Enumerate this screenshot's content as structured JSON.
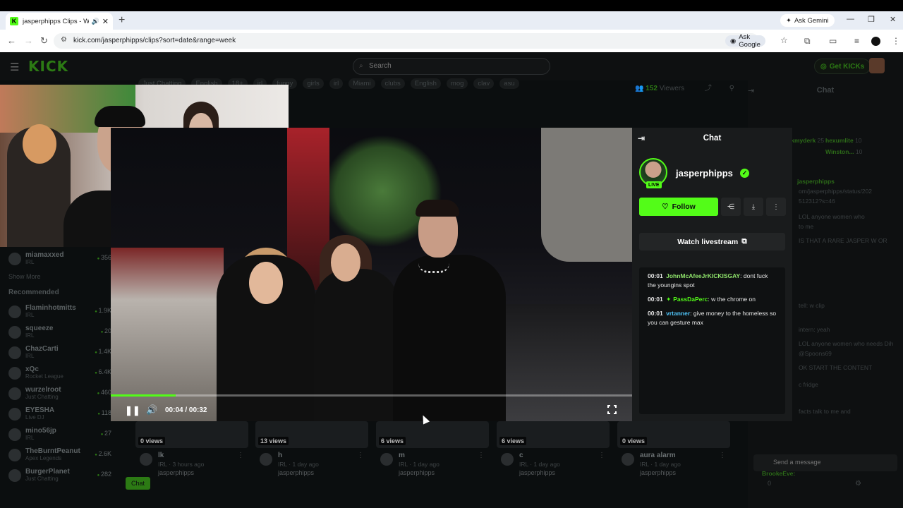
{
  "browser": {
    "tab_title": "jasperphipps Clips - Watch",
    "tab_favicon": "K",
    "new_tab": "+",
    "ask_gemini": "Ask Gemini",
    "url": "kick.com/jasperphipps/clips?sort=date&range=week",
    "ask_google": "Ask Google"
  },
  "topbar": {
    "logo": "KICK",
    "search_placeholder": "Search",
    "get_kicks": "Get KICKs"
  },
  "stream_info": {
    "tags": [
      "Just Chatting",
      "English",
      "18+",
      "irl",
      "funny",
      "girls",
      "irl",
      "Miami",
      "clubs",
      "English",
      "mog",
      "clav",
      "asu"
    ],
    "viewers_count": "152",
    "viewers_label": "Viewers"
  },
  "sidebar": {
    "following_tail": [
      {
        "name": "miamaxxed",
        "category": "IRL",
        "count": "356"
      }
    ],
    "show_more": "Show More",
    "recommended_label": "Recommended",
    "recommended": [
      {
        "name": "Flaminhotmitts",
        "category": "IRL",
        "count": "1.9K"
      },
      {
        "name": "squeeze",
        "category": "IRL",
        "count": "20"
      },
      {
        "name": "ChazCarti",
        "category": "IRL",
        "count": "1.4K"
      },
      {
        "name": "xQc",
        "category": "Rocket League",
        "count": "6.4K"
      },
      {
        "name": "wurzelroot",
        "category": "Just Chatting",
        "count": "460"
      },
      {
        "name": "EYESHA",
        "category": "Live DJ",
        "count": "118"
      },
      {
        "name": "mino56jp",
        "category": "IRL",
        "count": "27"
      },
      {
        "name": "TheBurntPeanut",
        "category": "Apex Legends",
        "count": "2.6K"
      },
      {
        "name": "BurgerPlanet",
        "category": "Just Chatting",
        "count": "282"
      }
    ]
  },
  "player": {
    "elapsed": "00:04",
    "duration": "00:32",
    "progress_fraction": 0.125
  },
  "clip_panel": {
    "header": "Chat",
    "streamer": "jasperphipps",
    "live_badge": "LIVE",
    "follow_label": "Follow",
    "watch_livestream": "Watch livestream",
    "messages": [
      {
        "time": "00:01",
        "user": "JohnMcAfeeJrKICKISGAY",
        "user_color": "#8fe36b",
        "text": "dont fuck the youngins spot"
      },
      {
        "time": "00:01",
        "user": "PassDaPerc",
        "user_color": "#53fc18",
        "text": "w the chrome on"
      },
      {
        "time": "00:01",
        "user": "vrtanner",
        "user_color": "#4fc3f7",
        "text": "give money to the homeless so you can gesture max"
      }
    ]
  },
  "bg_chat": {
    "title": "Chat",
    "lines": [
      {
        "user": "Smerkmyderk",
        "text": "25"
      },
      {
        "user": "hexumlite",
        "text": "10"
      },
      {
        "user": "Winston...",
        "text": "10"
      },
      {
        "user": "jasperphipps",
        "text": ""
      },
      {
        "user": "",
        "text": "om/jasperphipps/status/202"
      },
      {
        "user": "",
        "text": "512312?s=46"
      },
      {
        "user": "",
        "text": "LOL anyone women who"
      },
      {
        "user": "",
        "text": "to me"
      },
      {
        "user": "",
        "text": "IS THAT A RARE JASPER W OR"
      },
      {
        "user": "",
        "text": "tell: w clip"
      },
      {
        "user": "",
        "text": "intern: yeah"
      },
      {
        "user": "",
        "text": "LOL anyone women who needs Dih"
      },
      {
        "user": "",
        "text": "@Spoons69"
      },
      {
        "user": "",
        "text": "OK START THE CONTENT"
      },
      {
        "user": "",
        "text": "c fridge"
      },
      {
        "user": "",
        "text": "facts talk to me and"
      },
      {
        "user": "BrookeEve:",
        "text": ""
      }
    ],
    "send_placeholder": "Send a message",
    "kicks_count": "0",
    "chat_button": "Chat"
  },
  "clips": [
    {
      "views": "0 views",
      "title": "lk",
      "meta": "IRL · 3 hours ago",
      "channel": "jasperphipps"
    },
    {
      "views": "13 views",
      "title": "h",
      "meta": "IRL · 1 day ago",
      "channel": "jasperphipps"
    },
    {
      "views": "6 views",
      "title": "m",
      "meta": "IRL · 1 day ago",
      "channel": "jasperphipps"
    },
    {
      "views": "6 views",
      "title": "c",
      "meta": "IRL · 1 day ago",
      "channel": "jasperphipps"
    },
    {
      "views": "0 views",
      "title": "aura alarm",
      "meta": "IRL · 1 day ago",
      "channel": "jasperphipps"
    }
  ],
  "colors": {
    "brand": "#53fc18",
    "panel": "#191b1c",
    "page": "#0b0e0f"
  }
}
